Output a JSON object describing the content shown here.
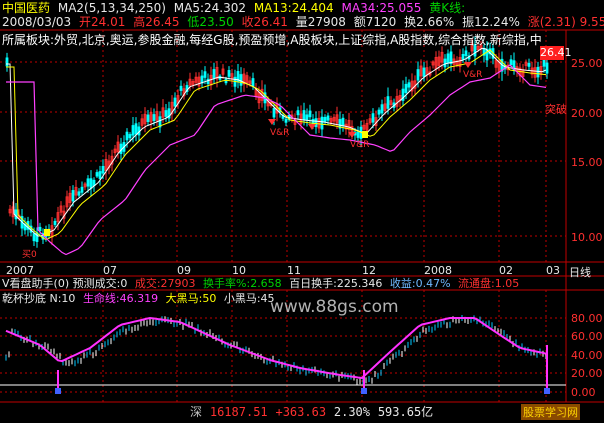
{
  "header": {
    "stock_name": "中国医药",
    "ma_params": "MA2(5,13,34,250)",
    "ma5": "MA5:24.302",
    "ma13": "MA13:24.404",
    "ma34": "MA34:25.055",
    "line_label": "黄K线:",
    "date": "2008/03/03",
    "open": "开24.01",
    "high": "高26.45",
    "low": "低23.50",
    "close": "收26.41",
    "volume": "量27908",
    "amount": "额7120",
    "turnover": "换2.66%",
    "amplitude_label": "振12.24%",
    "change": "涨(2.31)",
    "change_pct": "9.55",
    "sectors": "所属板块:外贸,北京,奥运,参股金融,每经G股,预盈预增,A股板块,上证综指,A股指数,综合指数,新综指,中"
  },
  "price_axis": {
    "current": "26.41",
    "ticks": [
      "25.00",
      "20.00",
      "15.00",
      "10.00"
    ],
    "breakout_label": "突破"
  },
  "markers": {
    "buy": "买0",
    "sell": "V&R"
  },
  "time_axis": {
    "labels": [
      "2007",
      "07",
      "09",
      "10",
      "11",
      "12",
      "2008",
      "02",
      "03"
    ],
    "period": "日线"
  },
  "indicator1": {
    "name": "V看盘助手(0)",
    "forecast": "预测成交:0",
    "deal": "成交:27903",
    "turnover_rate": "换手率%:2.658",
    "hundred_turnover": "百日换手:225.346",
    "gain": "收益:0.47%",
    "float_shares": "流通盘:1.05"
  },
  "indicator2": {
    "name": "乾杯抄底 N:10",
    "life_line": "生命线:46.319",
    "big_horse": "大黑马:50",
    "small_horse": "小黑马:45",
    "ticks": [
      "80.00",
      "60.00",
      "40.00",
      "20.00",
      "0.00"
    ],
    "watermark": "www.88gs.com"
  },
  "status_bar": {
    "market": "深",
    "index": "16187.51",
    "change": "+363.63",
    "pct": "2.30%",
    "amount": "593.65亿",
    "logo": "股票学习网"
  },
  "colors": {
    "up": "#ff3030",
    "down": "#00ffff",
    "ma5": "#ffffff",
    "ma13": "#ffff00",
    "ma34": "#ff40ff"
  }
}
